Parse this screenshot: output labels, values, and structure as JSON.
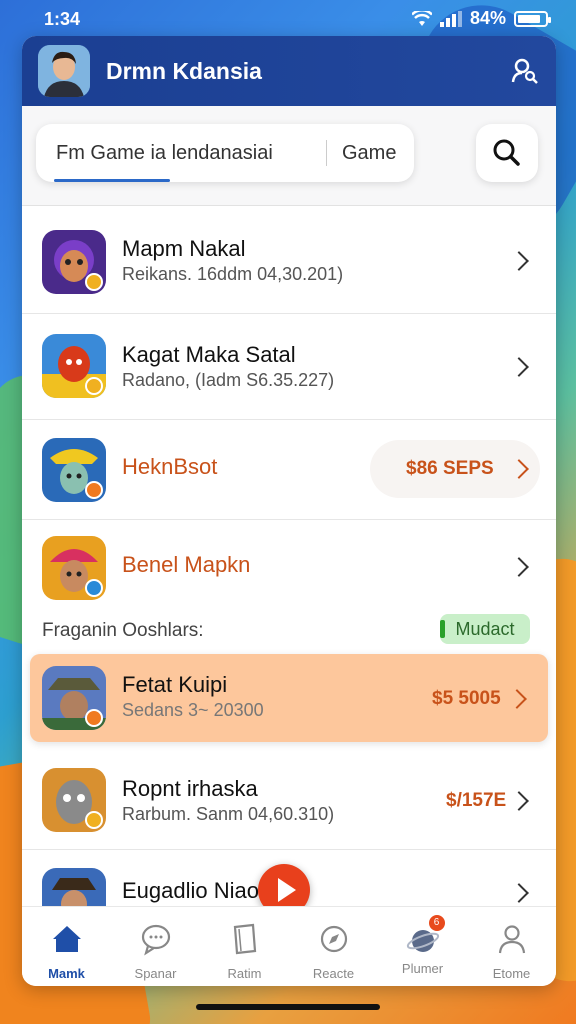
{
  "status": {
    "time": "1:34",
    "battery": "84%",
    "battery_level": 0.84
  },
  "header": {
    "title": "Drmn Kdansia"
  },
  "search": {
    "query": "Fm Game ia lendanasiai",
    "category": "Game"
  },
  "games": [
    {
      "title": "Mapm Nakal",
      "subtitle": "Reikans. 16ddm 04,30.201)",
      "price": ""
    },
    {
      "title": "Kagat Maka Satal",
      "subtitle": "Radano, (Iadm S6.35.227)",
      "price": ""
    },
    {
      "title": "HeknBsot",
      "subtitle": "",
      "price": "$86 SEPS"
    },
    {
      "title": "Benel Mapkn",
      "subtitle": "",
      "price": ""
    }
  ],
  "section": {
    "label": "Fraganin Ooshlars:",
    "tag": "Mudact"
  },
  "featured": {
    "title": "Fetat Kuipi",
    "subtitle": "Sedans 3~ 20300",
    "price": "$5 5005"
  },
  "more_games": [
    {
      "title": "Ropnt irhaska",
      "subtitle": "Rarbum. Sanm 04,60.310)",
      "price": "$/157E"
    },
    {
      "title": "Eugadlio Niao",
      "subtitle": "",
      "price": ""
    }
  ],
  "tabs": [
    {
      "label": "Mamk",
      "icon": "home-icon",
      "active": true
    },
    {
      "label": "Spanar",
      "icon": "chat-icon",
      "active": false
    },
    {
      "label": "Ratim",
      "icon": "book-icon",
      "active": false
    },
    {
      "label": "Reacte",
      "icon": "compass-icon",
      "active": false
    },
    {
      "label": "Plumer",
      "icon": "planet-icon",
      "badge": "6",
      "active": false
    },
    {
      "label": "Etome",
      "icon": "person-icon",
      "active": false
    }
  ],
  "colors": {
    "header": "#1b3f92",
    "accent": "#2b69c8",
    "price": "#c8521a",
    "highlight": "#fdc79c",
    "fab": "#e8401c"
  }
}
